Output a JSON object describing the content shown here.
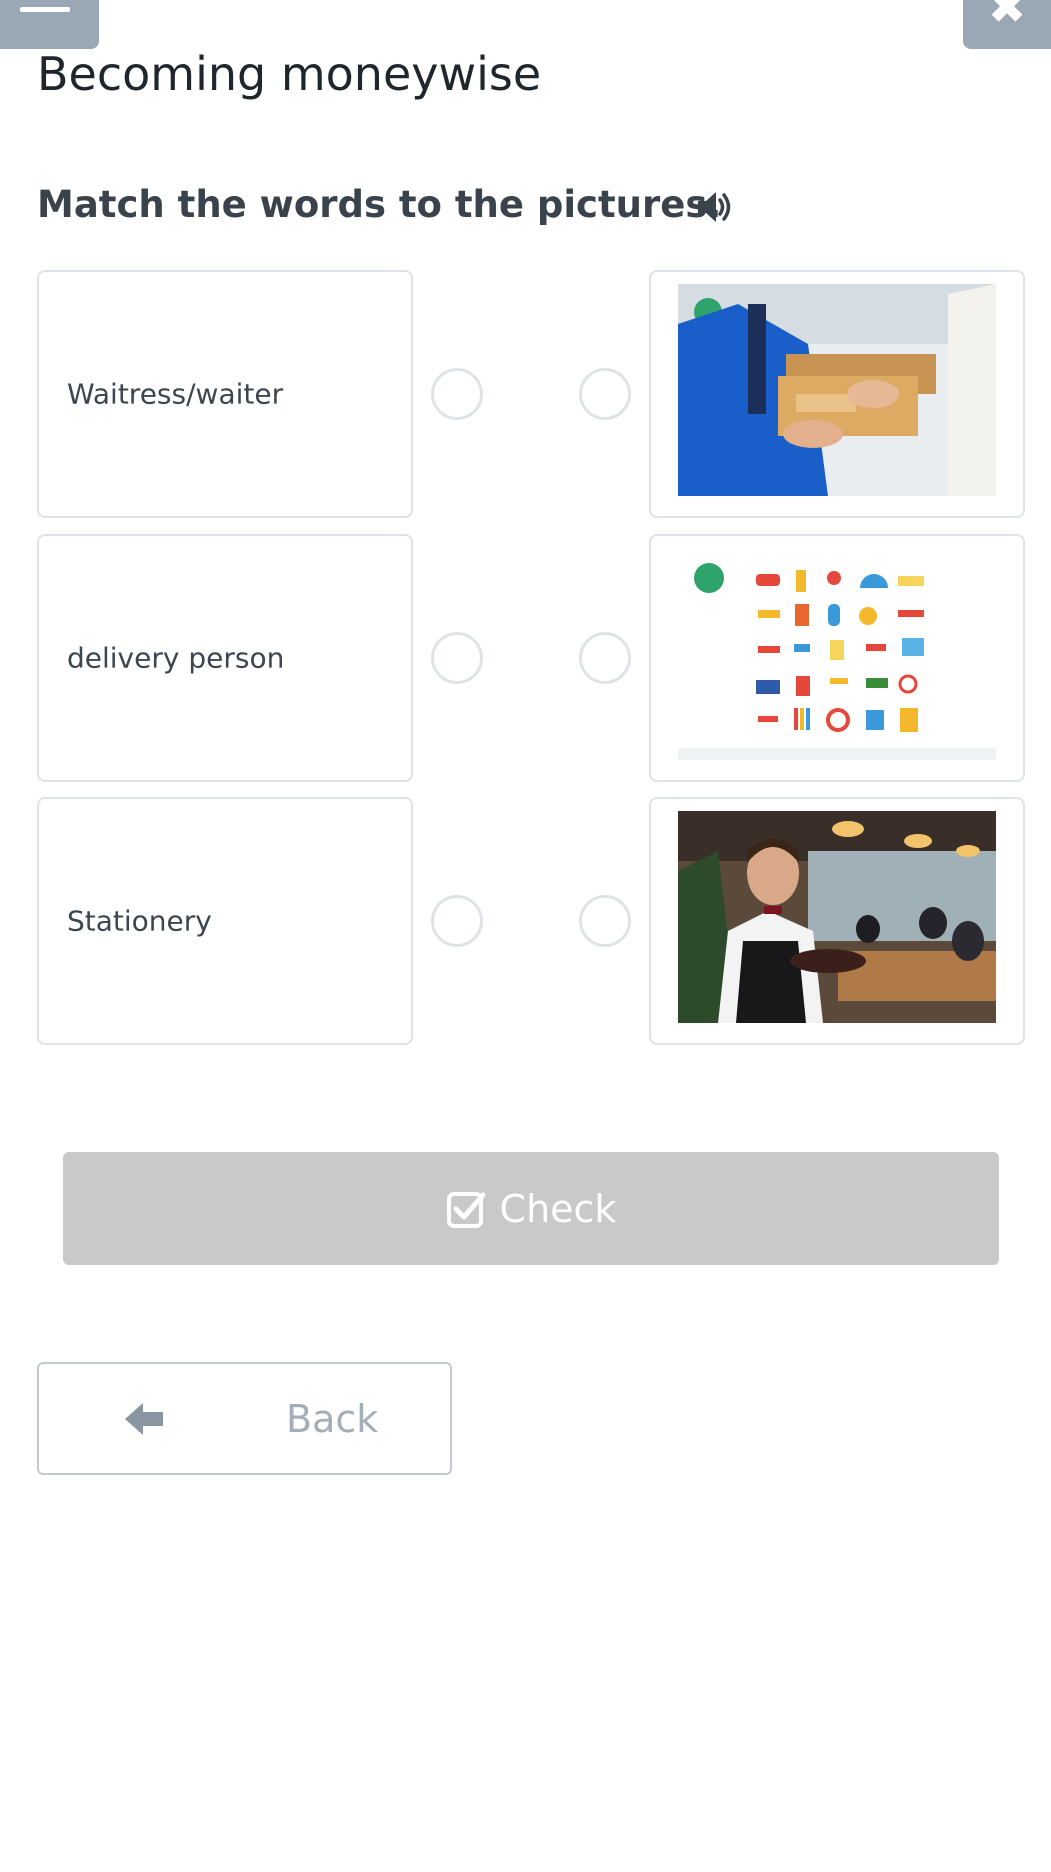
{
  "header": {
    "title": "Becoming moneywise",
    "menu_icon": "hamburger-icon",
    "close_icon": "close-icon"
  },
  "exercise": {
    "instruction": "Match the words to the pictures.",
    "audio_icon": "speaker-icon",
    "words": [
      {
        "label": "Waitress/waiter"
      },
      {
        "label": "delivery person"
      },
      {
        "label": "Stationery"
      }
    ],
    "pictures": [
      {
        "depicts": "delivery-person-handing-boxes"
      },
      {
        "depicts": "stationery-items"
      },
      {
        "depicts": "waiter-in-restaurant"
      }
    ]
  },
  "actions": {
    "check_label": "Check",
    "check_icon": "check-square-icon",
    "back_label": "Back",
    "back_icon": "arrow-left-icon"
  },
  "colors": {
    "header_button": "#9aa8b6",
    "check_disabled": "#c9c9c9",
    "border": "#dfe3e7"
  }
}
